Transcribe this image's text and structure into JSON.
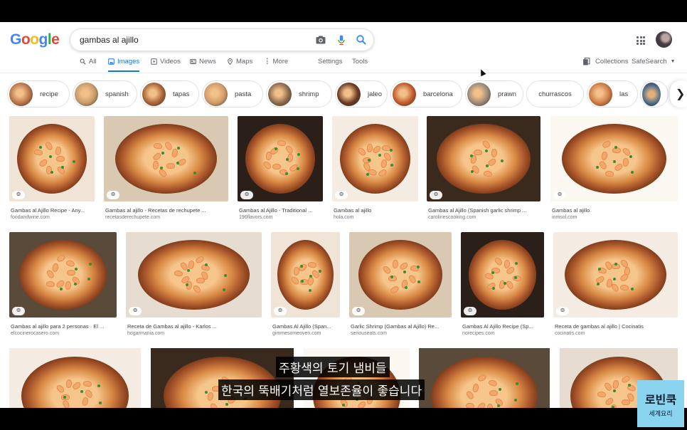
{
  "search": {
    "query": "gambas al ajillo"
  },
  "logo": {
    "text": "Google"
  },
  "tabs": [
    {
      "label": "All",
      "icon": "search-icon"
    },
    {
      "label": "Images",
      "icon": "image-icon",
      "active": true
    },
    {
      "label": "Videos",
      "icon": "video-icon"
    },
    {
      "label": "News",
      "icon": "news-icon"
    },
    {
      "label": "Maps",
      "icon": "map-pin-icon"
    },
    {
      "label": "More",
      "icon": "more-vert-icon"
    }
  ],
  "tools": {
    "settings": "Settings",
    "tools": "Tools"
  },
  "right": {
    "collections": "Collections",
    "safesearch": "SafeSearch"
  },
  "chips": [
    "recipe",
    "spanish",
    "tapas",
    "pasta",
    "shrimp",
    "jaleo",
    "barcelona",
    "prawn",
    "churrascos",
    "las"
  ],
  "results": [
    {
      "title": "Gambas al Ajillo Recipe - Any...",
      "source": "foodandwine.com"
    },
    {
      "title": "Gambas al ajillo - Recetas de rechupete ...",
      "source": "recetasderechupete.com"
    },
    {
      "title": "Gambas al Ajillo - Traditional ...",
      "source": "196flavors.com"
    },
    {
      "title": "Gambas al ajillo",
      "source": "hola.com"
    },
    {
      "title": "Gambas al Ajillo (Spanish garlic shrimp ...",
      "source": "carolinescooking.com"
    },
    {
      "title": "Gambas al ajillo",
      "source": "inmsol.com"
    },
    {
      "title": "Gambas al ajillo para 2 personas · El ...",
      "source": "elcocinerocasero.com"
    },
    {
      "title": "Receta de Gambas al ajillo - Karlos ...",
      "source": "hogarmania.com"
    },
    {
      "title": "Gambas Al Ajillo (Span...",
      "source": "gimmesomeoven.com"
    },
    {
      "title": "Garlic Shrimp (Gambas al Ajillo) Re...",
      "source": "seriouseats.com"
    },
    {
      "title": "Gambas Al Ajillo Recipe (Sp...",
      "source": "norecipes.com"
    },
    {
      "title": "Receta de gambas al ajillo | Cocinatis",
      "source": "cocinatis.com"
    }
  ],
  "subtitles": {
    "line1": "주황색의 토기 냄비들",
    "line2": "한국의 뚝배기처럼 열보존율이 좋습니다"
  },
  "brand": {
    "name": "로빈쿡",
    "tag": "세계요리"
  },
  "colors": {
    "accent": "#1a73e8",
    "clay": "#a8552a",
    "shrimp": "#f2a86b",
    "brand_bg": "#8ad4f0"
  }
}
